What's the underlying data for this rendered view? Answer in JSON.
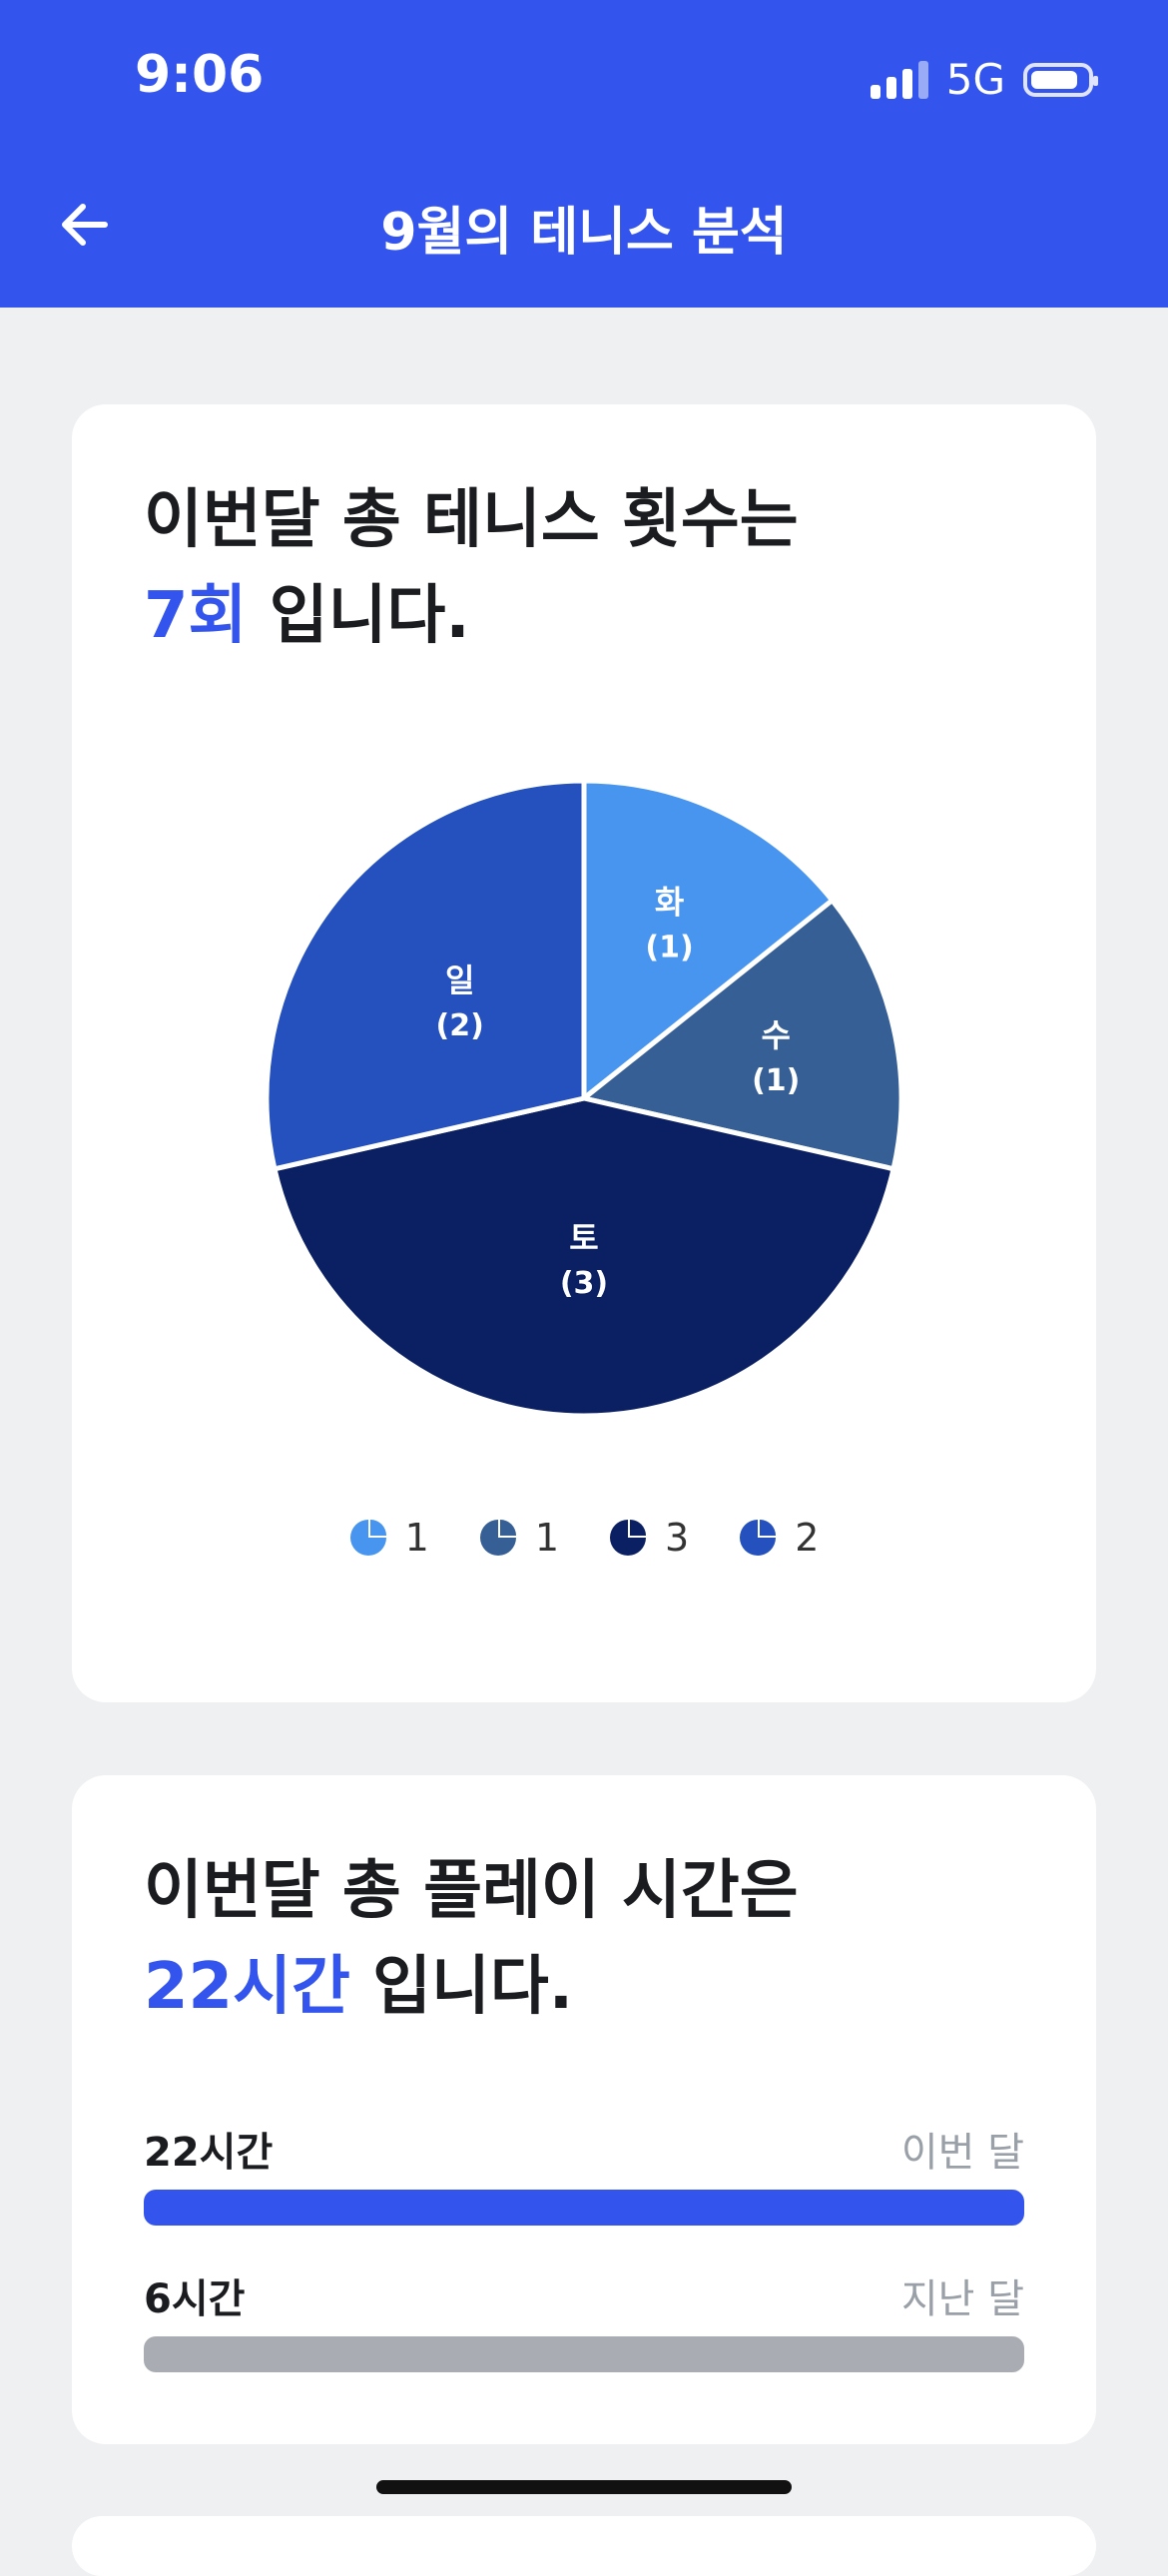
{
  "status_bar": {
    "time": "9:06",
    "network": "5G"
  },
  "header": {
    "title": "9월의 테니스 분석",
    "back_icon": "arrow-left-icon"
  },
  "tennis_count_card": {
    "line1": "이번달 총 테니스 횟수는",
    "count": "7회",
    "suffix": " 입니다."
  },
  "chart_data": {
    "type": "pie",
    "slices": [
      {
        "label": "화",
        "value": 1,
        "display": "(1)",
        "color": "#4895f0"
      },
      {
        "label": "수",
        "value": 1,
        "display": "(1)",
        "color": "#365f95"
      },
      {
        "label": "토",
        "value": 3,
        "display": "(3)",
        "color": "#0b2063"
      },
      {
        "label": "일",
        "value": 2,
        "display": "(2)",
        "color": "#2451bd"
      }
    ],
    "legend": [
      "1",
      "1",
      "3",
      "2"
    ]
  },
  "play_time_card": {
    "line1": "이번달 총 플레이 시간은",
    "hours": "22시간",
    "suffix": " 입니다.",
    "bars": [
      {
        "value_label": "22시간",
        "caption": "이번 달",
        "hours": 22,
        "color": "#3355ee"
      },
      {
        "value_label": "6시간",
        "caption": "지난 달",
        "hours": 6,
        "color": "#a9acb3"
      }
    ]
  },
  "colors": {
    "accent": "#3355ee",
    "background": "#eff0f2"
  }
}
